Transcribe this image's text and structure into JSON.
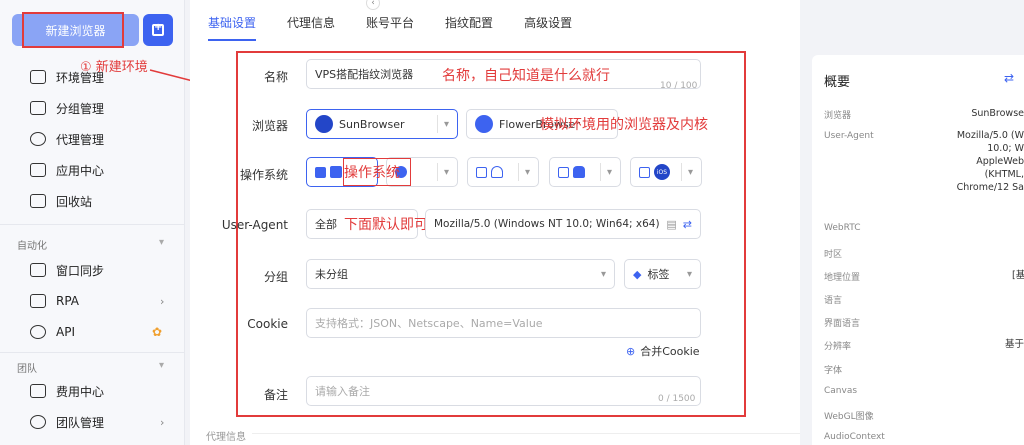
{
  "sidebar": {
    "new_button": "新建浏览器",
    "annotation_new": "① 新建环境",
    "items": [
      {
        "label": "环境管理",
        "icon": "window-icon"
      },
      {
        "label": "分组管理",
        "icon": "folder-icon"
      },
      {
        "label": "代理管理",
        "icon": "proxy-icon"
      },
      {
        "label": "应用中心",
        "icon": "puzzle-icon"
      },
      {
        "label": "回收站",
        "icon": "trash-icon"
      }
    ],
    "section_automation": "自动化",
    "automation_items": [
      {
        "label": "窗口同步",
        "icon": "sync-icon"
      },
      {
        "label": "RPA",
        "icon": "robot-icon"
      },
      {
        "label": "API",
        "icon": "api-icon"
      }
    ],
    "section_team": "团队",
    "team_items": [
      {
        "label": "费用中心",
        "icon": "billing-icon"
      },
      {
        "label": "团队管理",
        "icon": "team-icon"
      }
    ]
  },
  "tabs": [
    "基础设置",
    "代理信息",
    "账号平台",
    "指纹配置",
    "高级设置"
  ],
  "form": {
    "name_label": "名称",
    "name_value": "VPS搭配指纹浏览器",
    "name_counter": "10 / 100",
    "name_annotation": "名称，自己知道是什么就行",
    "browser_label": "浏览器",
    "browser_primary": "SunBrowser",
    "browser_secondary": "FlowerBrowser",
    "browser_annotation": "模拟环境用的浏览器及内核",
    "os_label": "操作系统",
    "os_annotation": "操作系统",
    "os_ios": "iOS",
    "ua_label": "User-Agent",
    "ua_scope": "全部",
    "ua_value": "Mozilla/5.0 (Windows NT 10.0; Win64; x64)",
    "ua_annotation": "下面默认即可",
    "group_label": "分组",
    "group_value": "未分组",
    "tag_label": "标签",
    "cookie_label": "Cookie",
    "cookie_placeholder": "支持格式：JSON、Netscape、Name=Value",
    "merge_cookie": "合并Cookie",
    "note_label": "备注",
    "note_placeholder": "请输入备注",
    "note_counter": "0 / 1500",
    "next_section": "代理信息"
  },
  "overview": {
    "title": "概要",
    "rows": [
      {
        "key": "浏览器",
        "value": "SunBrowse"
      },
      {
        "key": "User-Agent",
        "value": "Mozilla/5.0 (W 10.0; W AppleWeb (KHTML, Chrome/12 Sa"
      },
      {
        "key": "WebRTC",
        "value": ""
      },
      {
        "key": "时区",
        "value": ""
      },
      {
        "key": "地理位置",
        "value": "[基"
      },
      {
        "key": "语言",
        "value": ""
      },
      {
        "key": "界面语言",
        "value": ""
      },
      {
        "key": "分辨率",
        "value": "基于"
      },
      {
        "key": "字体",
        "value": ""
      },
      {
        "key": "Canvas",
        "value": ""
      },
      {
        "key": "WebGL图像",
        "value": ""
      },
      {
        "key": "AudioContext",
        "value": ""
      }
    ]
  },
  "colors": {
    "accent": "#3d63f0",
    "annotation": "#e23b3b"
  }
}
